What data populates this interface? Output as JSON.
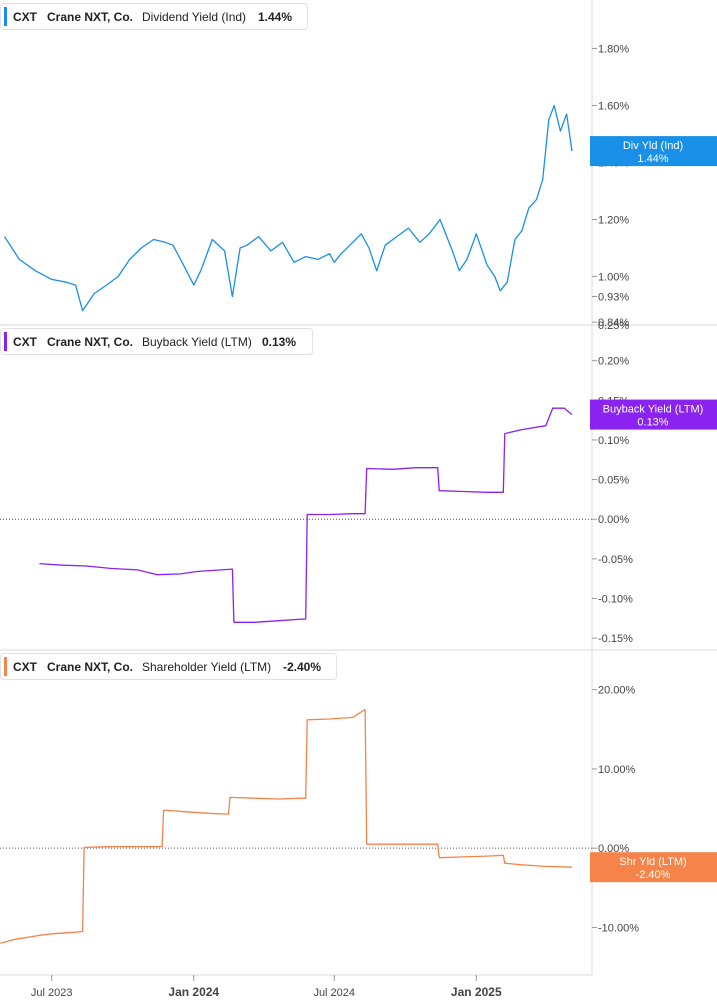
{
  "colors": {
    "dividend": "#1a8fe8",
    "buyback": "#8a22f0",
    "shareholder": "#f5834a",
    "grid": "#d8d8d8",
    "text": "#444444"
  },
  "x_axis": {
    "ticks": [
      {
        "date": "2023-07-01",
        "label": "Jul 2023",
        "bold": false
      },
      {
        "date": "2024-01-01",
        "label": "Jan 2024",
        "bold": true
      },
      {
        "date": "2024-07-01",
        "label": "Jul 2024",
        "bold": false
      },
      {
        "date": "2025-01-01",
        "label": "Jan 2025",
        "bold": true
      }
    ]
  },
  "chart_data": [
    {
      "type": "line",
      "ticker": "CXT",
      "company": "Crane NXT, Co.",
      "metric": "Dividend Yield (Ind)",
      "current": "1.44%",
      "badge": {
        "title": "Div Yld (Ind)",
        "value": "1.44%"
      },
      "ylim": [
        0.83,
        1.97
      ],
      "y_ticks": [
        {
          "v": 1.8,
          "label": "1.80%"
        },
        {
          "v": 1.6,
          "label": "1.60%"
        },
        {
          "v": 1.2,
          "label": "1.20%"
        },
        {
          "v": 1.0,
          "label": "1.00%"
        },
        {
          "v": 0.93,
          "label": "0.93%"
        },
        {
          "v": 0.84,
          "label": "0.84%"
        }
      ],
      "partial_tick": {
        "v": 1.4,
        "label": "1.40%"
      },
      "zero_line": false,
      "series": [
        {
          "x": [
            "2023-05-01",
            "2023-05-20",
            "2023-06-10",
            "2023-07-01",
            "2023-07-20",
            "2023-08-01",
            "2023-08-10",
            "2023-08-25",
            "2023-09-10",
            "2023-09-25",
            "2023-10-10",
            "2023-10-25",
            "2023-11-10",
            "2023-11-25",
            "2023-12-05",
            "2023-12-15",
            "2024-01-01",
            "2024-01-10",
            "2024-01-25",
            "2024-02-10",
            "2024-02-20",
            "2024-03-01",
            "2024-03-10",
            "2024-03-25",
            "2024-04-10",
            "2024-04-25",
            "2024-05-10",
            "2024-05-25",
            "2024-06-10",
            "2024-06-25",
            "2024-07-01",
            "2024-07-10",
            "2024-07-25",
            "2024-08-05",
            "2024-08-15",
            "2024-08-25",
            "2024-09-05",
            "2024-09-20",
            "2024-10-05",
            "2024-10-20",
            "2024-11-01",
            "2024-11-15",
            "2024-12-01",
            "2024-12-10",
            "2024-12-20",
            "2025-01-01",
            "2025-01-15",
            "2025-01-25",
            "2025-02-01",
            "2025-02-10",
            "2025-02-20",
            "2025-03-01",
            "2025-03-10",
            "2025-03-20",
            "2025-03-28",
            "2025-04-05",
            "2025-04-12",
            "2025-04-20",
            "2025-04-28",
            "2025-05-05"
          ],
          "values": [
            1.14,
            1.06,
            1.02,
            0.99,
            0.98,
            0.97,
            0.88,
            0.94,
            0.97,
            1.0,
            1.06,
            1.1,
            1.13,
            1.12,
            1.11,
            1.06,
            0.97,
            1.02,
            1.13,
            1.09,
            0.93,
            1.1,
            1.11,
            1.14,
            1.09,
            1.12,
            1.05,
            1.07,
            1.06,
            1.08,
            1.05,
            1.08,
            1.12,
            1.15,
            1.1,
            1.02,
            1.11,
            1.14,
            1.17,
            1.12,
            1.15,
            1.2,
            1.09,
            1.02,
            1.06,
            1.15,
            1.04,
            1.0,
            0.95,
            0.98,
            1.13,
            1.16,
            1.24,
            1.27,
            1.34,
            1.55,
            1.6,
            1.51,
            1.57,
            1.44
          ]
        }
      ]
    },
    {
      "type": "line",
      "ticker": "CXT",
      "company": "Crane NXT, Co.",
      "metric": "Buyback Yield (LTM)",
      "current": "0.13%",
      "badge": {
        "title": "Buyback Yield (LTM)",
        "value": "0.13%"
      },
      "ylim": [
        -0.165,
        0.245
      ],
      "y_ticks": [
        {
          "v": 0.2,
          "label": "0.20%"
        },
        {
          "v": 0.1,
          "label": "0.10%"
        },
        {
          "v": 0.05,
          "label": "0.05%"
        },
        {
          "v": 0.0,
          "label": "0.00%"
        },
        {
          "v": -0.05,
          "label": "-0.05%"
        },
        {
          "v": -0.1,
          "label": "-0.10%"
        },
        {
          "v": -0.15,
          "label": "-0.15%"
        }
      ],
      "partial_tick": {
        "v": 0.15,
        "label": "0.15%"
      },
      "top_cut_label": "0.25%",
      "zero_line": true,
      "series": [
        {
          "x": [
            "2023-06-15",
            "2023-07-15",
            "2023-08-15",
            "2023-09-15",
            "2023-10-20",
            "2023-11-15",
            "2023-12-15",
            "2024-01-05",
            "2024-02-05",
            "2024-02-20",
            "2024-02-22",
            "2024-03-20",
            "2024-04-20",
            "2024-05-20",
            "2024-05-25",
            "2024-05-27",
            "2024-06-25",
            "2024-07-25",
            "2024-08-10",
            "2024-08-12",
            "2024-09-15",
            "2024-10-15",
            "2024-11-12",
            "2024-11-14",
            "2024-12-15",
            "2025-01-15",
            "2025-02-05",
            "2025-02-07",
            "2025-03-01",
            "2025-04-01",
            "2025-04-10",
            "2025-04-25",
            "2025-05-05"
          ],
          "values": [
            -0.056,
            -0.058,
            -0.059,
            -0.062,
            -0.064,
            -0.07,
            -0.069,
            -0.066,
            -0.064,
            -0.063,
            -0.13,
            -0.13,
            -0.128,
            -0.126,
            -0.126,
            0.006,
            0.006,
            0.007,
            0.007,
            0.064,
            0.063,
            0.065,
            0.065,
            0.036,
            0.035,
            0.034,
            0.034,
            0.108,
            0.113,
            0.118,
            0.14,
            0.14,
            0.132
          ]
        }
      ]
    },
    {
      "type": "line",
      "ticker": "CXT",
      "company": "Crane NXT, Co.",
      "metric": "Shareholder Yield (LTM)",
      "current": "-2.40%",
      "badge": {
        "title": "Shr Yld (LTM)",
        "value": "-2.40%"
      },
      "ylim": [
        -16,
        25
      ],
      "y_ticks": [
        {
          "v": 20,
          "label": "20.00%"
        },
        {
          "v": 10,
          "label": "10.00%"
        },
        {
          "v": 0,
          "label": "0.00%"
        },
        {
          "v": -10,
          "label": "-10.00%"
        }
      ],
      "zero_line": true,
      "series": [
        {
          "x": [
            "2023-04-25",
            "2023-05-15",
            "2023-06-15",
            "2023-07-01",
            "2023-08-01",
            "2023-08-10",
            "2023-08-12",
            "2023-09-15",
            "2023-11-15",
            "2023-11-21",
            "2023-11-23",
            "2023-12-20",
            "2024-01-20",
            "2024-02-15",
            "2024-02-17",
            "2024-03-20",
            "2024-04-20",
            "2024-05-20",
            "2024-05-25",
            "2024-05-27",
            "2024-06-25",
            "2024-07-25",
            "2024-08-10",
            "2024-08-12",
            "2024-09-15",
            "2024-10-15",
            "2024-11-12",
            "2024-11-14",
            "2024-12-15",
            "2025-01-15",
            "2025-02-05",
            "2025-02-07",
            "2025-03-01",
            "2025-04-01",
            "2025-05-05"
          ],
          "values": [
            -12.0,
            -11.5,
            -11.0,
            -10.8,
            -10.6,
            -10.5,
            0.1,
            0.2,
            0.2,
            0.2,
            4.8,
            4.6,
            4.4,
            4.3,
            6.4,
            6.3,
            6.2,
            6.3,
            6.3,
            16.2,
            16.3,
            16.5,
            17.5,
            0.5,
            0.5,
            0.5,
            0.5,
            -1.2,
            -1.1,
            -1.0,
            -0.9,
            -1.9,
            -2.1,
            -2.3,
            -2.4
          ]
        }
      ]
    }
  ]
}
